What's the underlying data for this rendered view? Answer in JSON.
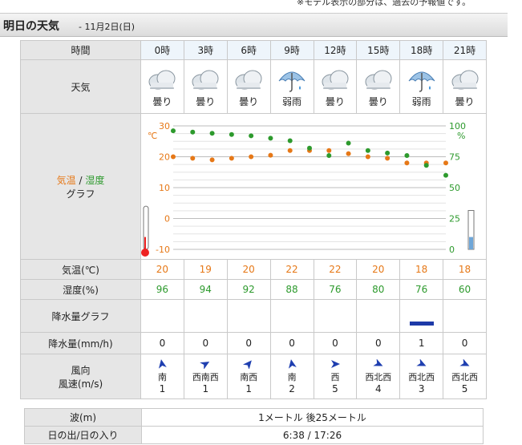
{
  "top_note": "※モデル表示の部分は、過去の予報値です。",
  "title": "明日の天気",
  "date": "- 11月2日(日)",
  "labels": {
    "time": "時間",
    "weather": "天気",
    "graph_temp": "気温",
    "graph_sep": " / ",
    "graph_hum": "湿度",
    "graph_suffix": "グラフ",
    "temp": "気温(℃)",
    "humidity": "湿度(%)",
    "precip_graph": "降水量グラフ",
    "precip": "降水量(mm/h)",
    "wind_dir": "風向",
    "wind_speed": "風速(m/s)",
    "wave": "波(m)",
    "sun": "日の出/日の入り"
  },
  "hours": [
    {
      "time": "0時",
      "icon": "cloud-icon",
      "weather": "曇り",
      "temp": "20",
      "humidity": "96",
      "precip": "0",
      "precip_amount": 0,
      "wind_dir": "南",
      "wind_speed": "1"
    },
    {
      "time": "3時",
      "icon": "cloud-icon",
      "weather": "曇り",
      "temp": "19",
      "humidity": "94",
      "precip": "0",
      "precip_amount": 0,
      "wind_dir": "西南西",
      "wind_speed": "1"
    },
    {
      "time": "6時",
      "icon": "cloud-icon",
      "weather": "曇り",
      "temp": "20",
      "humidity": "92",
      "precip": "0",
      "precip_amount": 0,
      "wind_dir": "南西",
      "wind_speed": "1"
    },
    {
      "time": "9時",
      "icon": "umbrella-icon",
      "weather": "弱雨",
      "temp": "22",
      "humidity": "88",
      "precip": "0",
      "precip_amount": 0,
      "wind_dir": "南",
      "wind_speed": "2"
    },
    {
      "time": "12時",
      "icon": "cloud-icon",
      "weather": "曇り",
      "temp": "22",
      "humidity": "76",
      "precip": "0",
      "precip_amount": 0,
      "wind_dir": "西",
      "wind_speed": "5"
    },
    {
      "time": "15時",
      "icon": "cloud-icon",
      "weather": "曇り",
      "temp": "20",
      "humidity": "80",
      "precip": "0",
      "precip_amount": 0,
      "wind_dir": "西北西",
      "wind_speed": "4"
    },
    {
      "time": "18時",
      "icon": "umbrella-icon",
      "weather": "弱雨",
      "temp": "18",
      "humidity": "76",
      "precip": "1",
      "precip_amount": 1,
      "wind_dir": "西北西",
      "wind_speed": "3"
    },
    {
      "time": "21時",
      "icon": "cloud-icon",
      "weather": "曇り",
      "temp": "18",
      "humidity": "60",
      "precip": "0",
      "precip_amount": 0,
      "wind_dir": "西北西",
      "wind_speed": "5"
    }
  ],
  "wave": "1メートル 後25メートル",
  "sun": "6:38 / 17:26",
  "colors": {
    "temp": "#e67817",
    "humidity": "#2d9a2d",
    "precip_bar": "#1d3aa8",
    "wind_arrow": "#1f3fb0",
    "wind_arrow_light": "#3aa34a"
  },
  "chart_data": {
    "type": "line",
    "x": [
      0,
      1.5,
      3,
      4.5,
      6,
      7.5,
      9,
      10.5,
      12,
      13.5,
      15,
      16.5,
      18,
      19.5,
      21
    ],
    "series": [
      {
        "name": "気温",
        "axis": "left",
        "values": [
          20,
          19.5,
          19,
          19.5,
          20,
          20.5,
          22,
          22,
          22,
          21,
          20,
          19.5,
          18,
          18,
          18
        ]
      },
      {
        "name": "湿度",
        "axis": "right",
        "values": [
          96,
          95,
          94,
          93,
          92,
          90,
          88,
          82,
          76,
          86,
          80,
          78,
          76,
          68,
          60
        ]
      }
    ],
    "left_axis": {
      "ticks": [
        "30",
        "20",
        "10",
        "0",
        "-10"
      ],
      "unit": "℃",
      "range": [
        -10,
        30
      ]
    },
    "right_axis": {
      "ticks": [
        "100",
        "75",
        "50",
        "25",
        "0"
      ],
      "unit": "%",
      "range": [
        0,
        100
      ]
    }
  }
}
